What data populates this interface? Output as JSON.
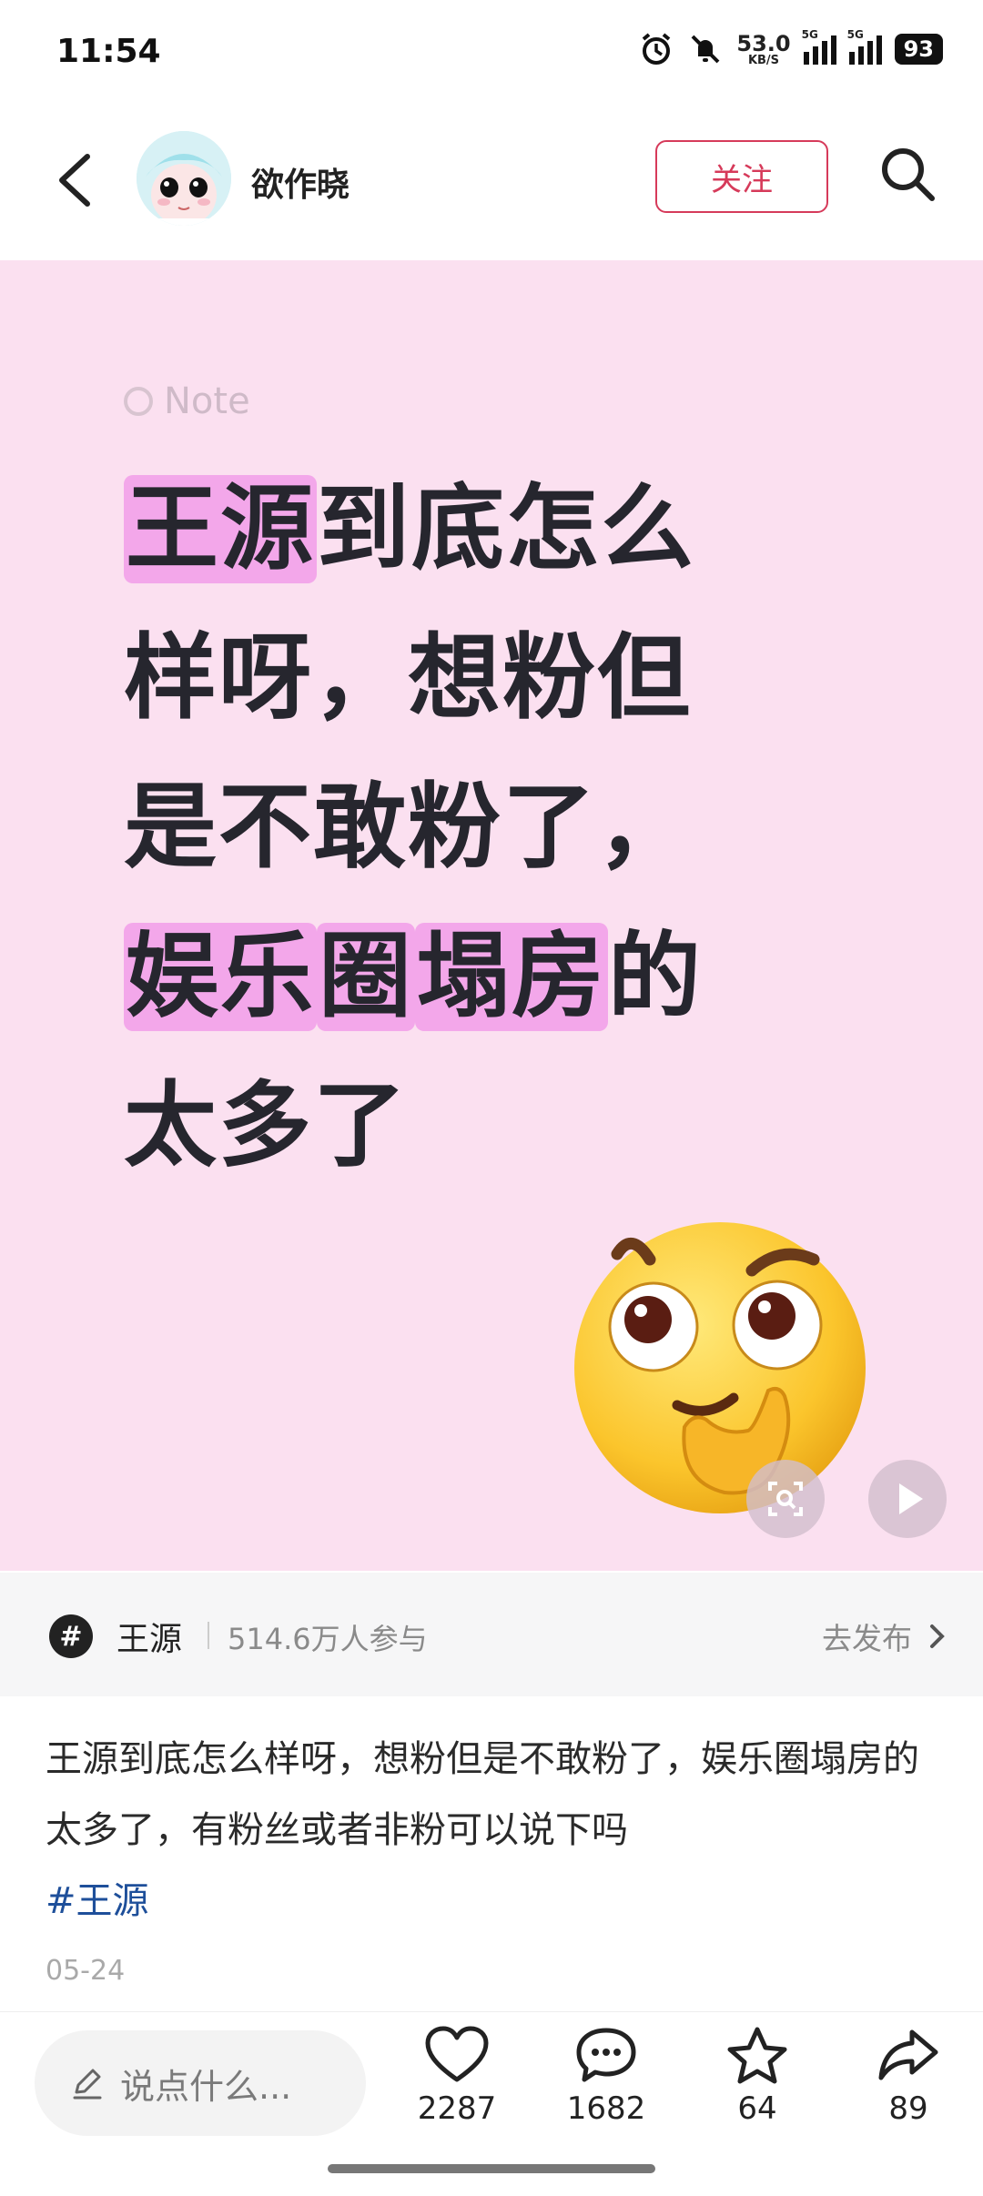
{
  "status_bar": {
    "time": "11:54",
    "net_speed_value": "53.0",
    "net_speed_unit": "KB/S",
    "sim1": "5G",
    "sim2": "5G",
    "battery": "93"
  },
  "header": {
    "author_name": "欲作晓",
    "follow_label": "关注"
  },
  "post_image": {
    "note_tag": "Note",
    "lines": [
      {
        "hl": "王源",
        "rest": "到底怎么"
      },
      {
        "hl": "",
        "rest": "样呀，想粉但"
      },
      {
        "hl": "",
        "rest": "是不敢粉了，"
      },
      {
        "hl": "娱乐",
        "mid": "圈",
        "hl2": "塌房",
        "rest": "的"
      },
      {
        "hl": "",
        "rest": "太多了"
      }
    ],
    "emoji": "thinking-face"
  },
  "topic": {
    "icon_symbol": "#",
    "name": "王源",
    "participants": "514.6万人参与",
    "go_label": "去发布"
  },
  "post": {
    "text": "王源到底怎么样呀，想粉但是不敢粉了，娱乐圈塌房的太多了，有粉丝或者非粉可以说下吗",
    "hashtag": "#王源",
    "date": "05-24"
  },
  "bottom_bar": {
    "comment_placeholder": "说点什么...",
    "likes": "2287",
    "comments": "1682",
    "favorites": "64",
    "shares": "89"
  },
  "colors": {
    "accent": "#d63a5a",
    "card_bg": "#fbe0f0",
    "highlight": "#f3a7ea",
    "hashtag": "#1e4f9a"
  }
}
